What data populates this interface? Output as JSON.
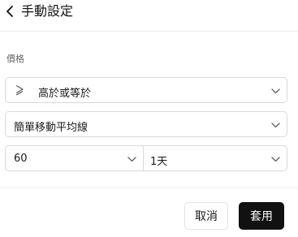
{
  "header": {
    "title": "手動設定"
  },
  "section": {
    "label": "價格"
  },
  "condition": {
    "value": "高於或等於",
    "icon": "greater-equal-icon"
  },
  "indicator": {
    "value": "簡單移動平均線"
  },
  "period": {
    "value": "60"
  },
  "timeframe": {
    "value": "1天"
  },
  "footer": {
    "cancel_label": "取消",
    "apply_label": "套用"
  },
  "colors": {
    "apply_bg": "#111111",
    "border": "#d9d9d9",
    "divider": "#ececec"
  }
}
